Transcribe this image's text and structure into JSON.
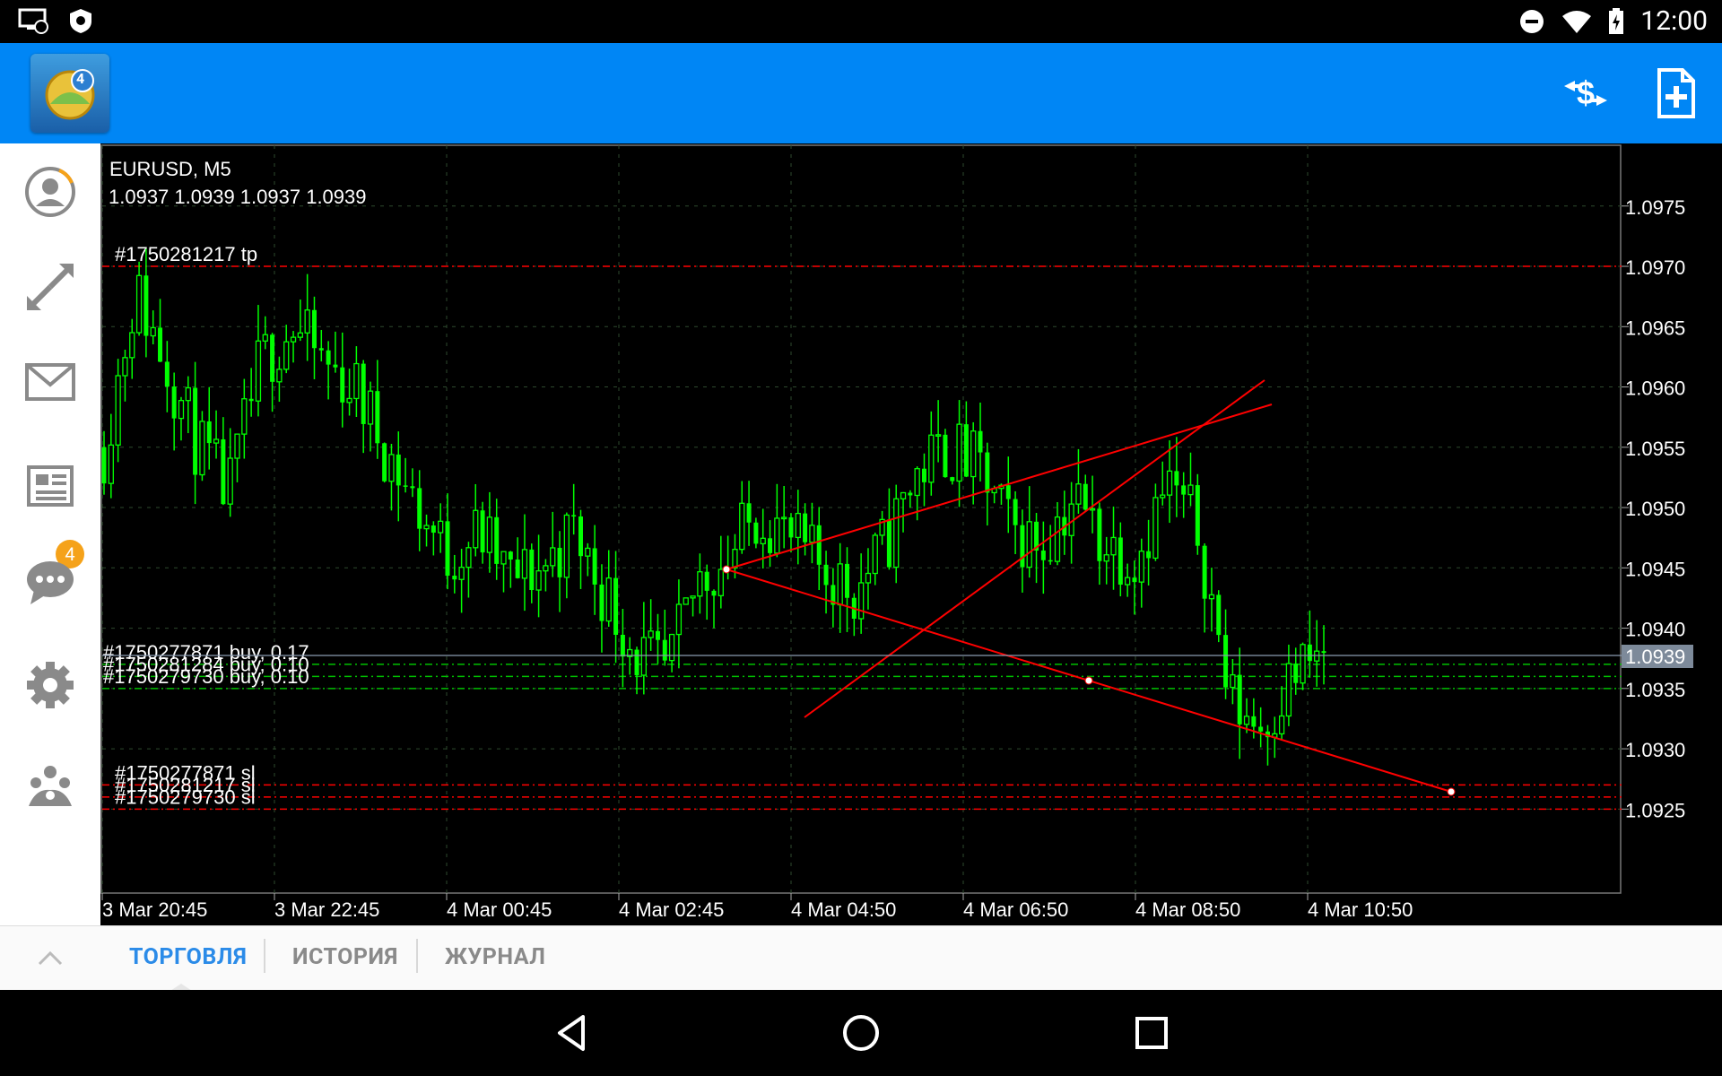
{
  "status_bar": {
    "time": "12:00"
  },
  "app_bar": {
    "logo_badge": "4"
  },
  "sidebar": {
    "mail_badge": "4"
  },
  "chart": {
    "symbol_line": "EURUSD, M5",
    "ohlc_line": "1.0937 1.0939 1.0937 1.0939",
    "current_price": "1.0939",
    "order_labels": {
      "tp": "#1750281217 tp",
      "buy1": "#1750277871 buy, 0.17",
      "buy2": "#1750281284 buy, 0.10",
      "buy3": "#1750279730 buy, 0.10",
      "sl1": "#1750277871 sl",
      "sl2": "#1750281217 sl",
      "sl3": "#1750279730 sl"
    },
    "colors": {
      "bullish": "#00ff00",
      "trendline": "#ff0000",
      "grid": "#2e4a2e",
      "level_sl_tp": "#ff0000",
      "level_order": "#00c000"
    }
  },
  "chart_data": {
    "type": "candlestick",
    "title": "EURUSD, M5",
    "ylim": [
      1.0918,
      1.098
    ],
    "y_ticks": [
      "1.0975",
      "1.0970",
      "1.0965",
      "1.0960",
      "1.0955",
      "1.0950",
      "1.0945",
      "1.0940",
      "1.0935",
      "1.0930",
      "1.0925"
    ],
    "x_ticks": [
      "3 Mar 20:45",
      "3 Mar 22:45",
      "4 Mar 00:45",
      "4 Mar 02:45",
      "4 Mar 04:50",
      "4 Mar 06:50",
      "4 Mar 08:50",
      "4 Mar 10:50"
    ],
    "levels": [
      {
        "label": "#1750281217 tp",
        "price": 1.097,
        "kind": "tp"
      },
      {
        "label": "#1750277871 buy, 0.17",
        "price": 1.0937,
        "kind": "buy"
      },
      {
        "label": "#1750281284 buy, 0.10",
        "price": 1.0936,
        "kind": "buy"
      },
      {
        "label": "#1750279730 buy, 0.10",
        "price": 1.0935,
        "kind": "buy"
      },
      {
        "label": "#1750277871 sl",
        "price": 1.0927,
        "kind": "sl"
      },
      {
        "label": "#1750281217 sl",
        "price": 1.0926,
        "kind": "sl"
      },
      {
        "label": "#1750279730 sl",
        "price": 1.0925,
        "kind": "sl"
      }
    ],
    "path": [
      1.0955,
      1.0968,
      1.0962,
      1.0955,
      1.0951,
      1.0962,
      1.0965,
      1.0962,
      1.096,
      1.0955,
      1.095,
      1.0946,
      1.0948,
      1.0944,
      1.0945,
      1.0948,
      1.0943,
      1.0938,
      1.0936,
      1.0944,
      1.0946,
      1.095,
      1.0947,
      1.0945,
      1.0943,
      1.0947,
      1.0953,
      1.0955,
      1.0953,
      1.0948,
      1.0947,
      1.0951,
      1.0947,
      1.0946,
      1.0952,
      1.0948,
      1.0934,
      1.0932,
      1.0936,
      1.0938
    ]
  },
  "tabs": [
    {
      "label": "ТОРГОВЛЯ",
      "active": true
    },
    {
      "label": "ИСТОРИЯ",
      "active": false
    },
    {
      "label": "ЖУРНАЛ",
      "active": false
    }
  ]
}
